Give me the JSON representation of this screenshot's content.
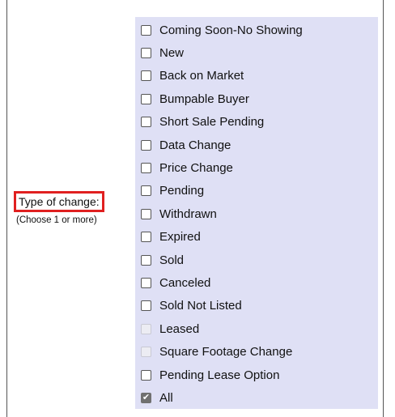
{
  "field": {
    "label": "Type of change:",
    "sublabel": "(Choose 1 or more)"
  },
  "options": [
    {
      "label": "Coming Soon-No Showing",
      "checked": false,
      "disabled": false
    },
    {
      "label": "New",
      "checked": false,
      "disabled": false
    },
    {
      "label": "Back on Market",
      "checked": false,
      "disabled": false
    },
    {
      "label": "Bumpable Buyer",
      "checked": false,
      "disabled": false
    },
    {
      "label": "Short Sale Pending",
      "checked": false,
      "disabled": false
    },
    {
      "label": "Data Change",
      "checked": false,
      "disabled": false
    },
    {
      "label": "Price Change",
      "checked": false,
      "disabled": false
    },
    {
      "label": "Pending",
      "checked": false,
      "disabled": false
    },
    {
      "label": "Withdrawn",
      "checked": false,
      "disabled": false
    },
    {
      "label": "Expired",
      "checked": false,
      "disabled": false
    },
    {
      "label": "Sold",
      "checked": false,
      "disabled": false
    },
    {
      "label": "Canceled",
      "checked": false,
      "disabled": false
    },
    {
      "label": "Sold Not Listed",
      "checked": false,
      "disabled": false
    },
    {
      "label": "Leased",
      "checked": false,
      "disabled": true
    },
    {
      "label": "Square Footage Change",
      "checked": false,
      "disabled": true
    },
    {
      "label": "Pending Lease Option",
      "checked": false,
      "disabled": false
    },
    {
      "label": "All",
      "checked": true,
      "disabled": false
    }
  ],
  "colors": {
    "highlight_border": "#e02020",
    "options_background": "#dfe0f5"
  }
}
